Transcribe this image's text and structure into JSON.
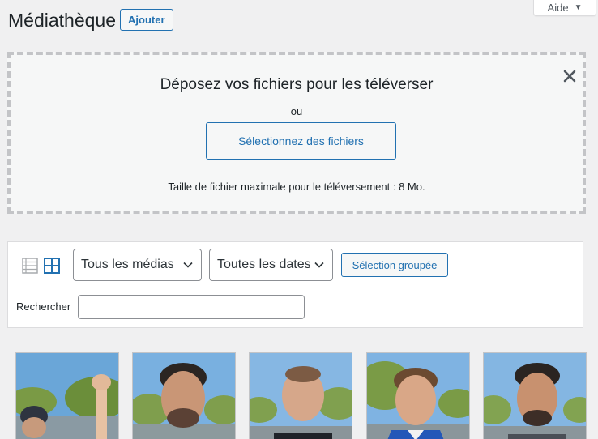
{
  "help": {
    "label": "Aide"
  },
  "header": {
    "title": "Médiathèque",
    "add_label": "Ajouter"
  },
  "uploader": {
    "title": "Déposez vos fichiers pour les téléverser",
    "or": "ou",
    "select_label": "Sélectionnez des fichiers",
    "max_size": "Taille de fichier maximale pour le téléversement : 8 Mo."
  },
  "toolbar": {
    "media_filter": "Tous les médias",
    "date_filter": "Toutes les dates",
    "bulk_select": "Sélection groupée",
    "search_label": "Rechercher",
    "search_value": ""
  },
  "colors": {
    "accent": "#2271b1",
    "background": "#f0f0f1"
  },
  "icons": [
    "close-icon",
    "list-view-icon",
    "grid-view-icon",
    "chevron-down-icon"
  ]
}
